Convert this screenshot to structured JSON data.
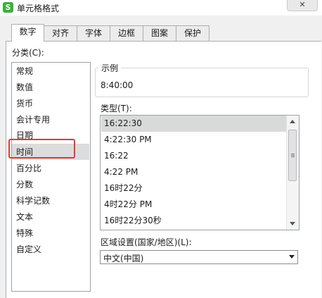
{
  "window": {
    "title": "单元格格式",
    "app_icon_letter": "S",
    "close_label": "✕"
  },
  "tabs": [
    "数字",
    "对齐",
    "字体",
    "边框",
    "图案",
    "保护"
  ],
  "category": {
    "label": "分类(C):",
    "items": [
      "常规",
      "数值",
      "货币",
      "会计专用",
      "日期",
      "时间",
      "百分比",
      "分数",
      "科学记数",
      "文本",
      "特殊",
      "自定义"
    ],
    "selected": "时间"
  },
  "sample": {
    "legend": "示例",
    "value": "8:40:00"
  },
  "type": {
    "label": "类型(T):",
    "items": [
      "16:22:30",
      "4:22:30 PM",
      "16:22",
      "4:22 PM",
      "16时22分",
      "4时22分 PM",
      "16时22分30秒"
    ],
    "selected": "16:22:30"
  },
  "locale": {
    "label": "区域设置(国家/地区)(L):",
    "value": "中文(中国)"
  },
  "colors": {
    "highlight": "#e23b30",
    "app_icon": "#3bb13b"
  }
}
